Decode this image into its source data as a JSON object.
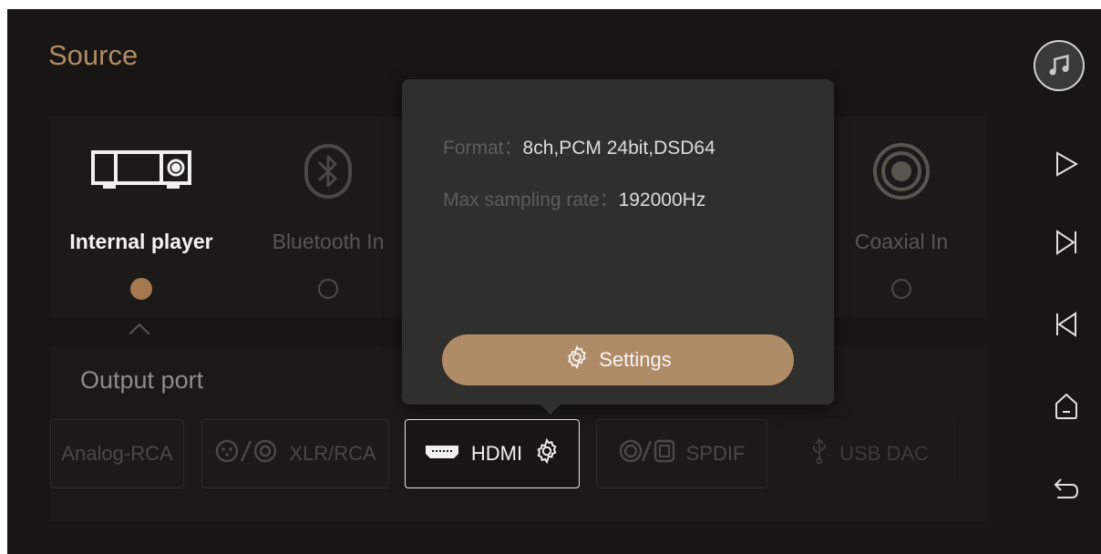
{
  "header": {
    "title": "Source"
  },
  "sources": [
    {
      "label": "Internal player",
      "icon": "internal-player-icon",
      "selected": true
    },
    {
      "label": "Bluetooth In",
      "icon": "bluetooth-icon",
      "selected": false
    },
    {
      "label": "Coaxial In",
      "icon": "coaxial-icon",
      "selected": false
    }
  ],
  "output": {
    "title": "Output port",
    "ports": [
      {
        "label": "Analog-RCA"
      },
      {
        "label": "XLR/RCA",
        "icon": "xlr-rca-icon"
      },
      {
        "label": "HDMI",
        "icon": "hdmi-icon",
        "selected": true
      },
      {
        "label": "SPDIF",
        "icon": "spdif-icon"
      },
      {
        "label": "USB DAC",
        "icon": "usb-icon"
      }
    ]
  },
  "popup": {
    "format_label": "Format：",
    "format_value": "8ch,PCM 24bit,DSD64",
    "rate_label": "Max sampling rate：",
    "rate_value": "192000Hz",
    "settings_label": "Settings"
  },
  "side_nav": [
    "music-note-icon",
    "play-icon",
    "next-icon",
    "previous-icon",
    "home-icon",
    "back-icon"
  ],
  "colors": {
    "accent": "#b08b67",
    "background": "#171614",
    "popup": "#2f2f2e"
  }
}
